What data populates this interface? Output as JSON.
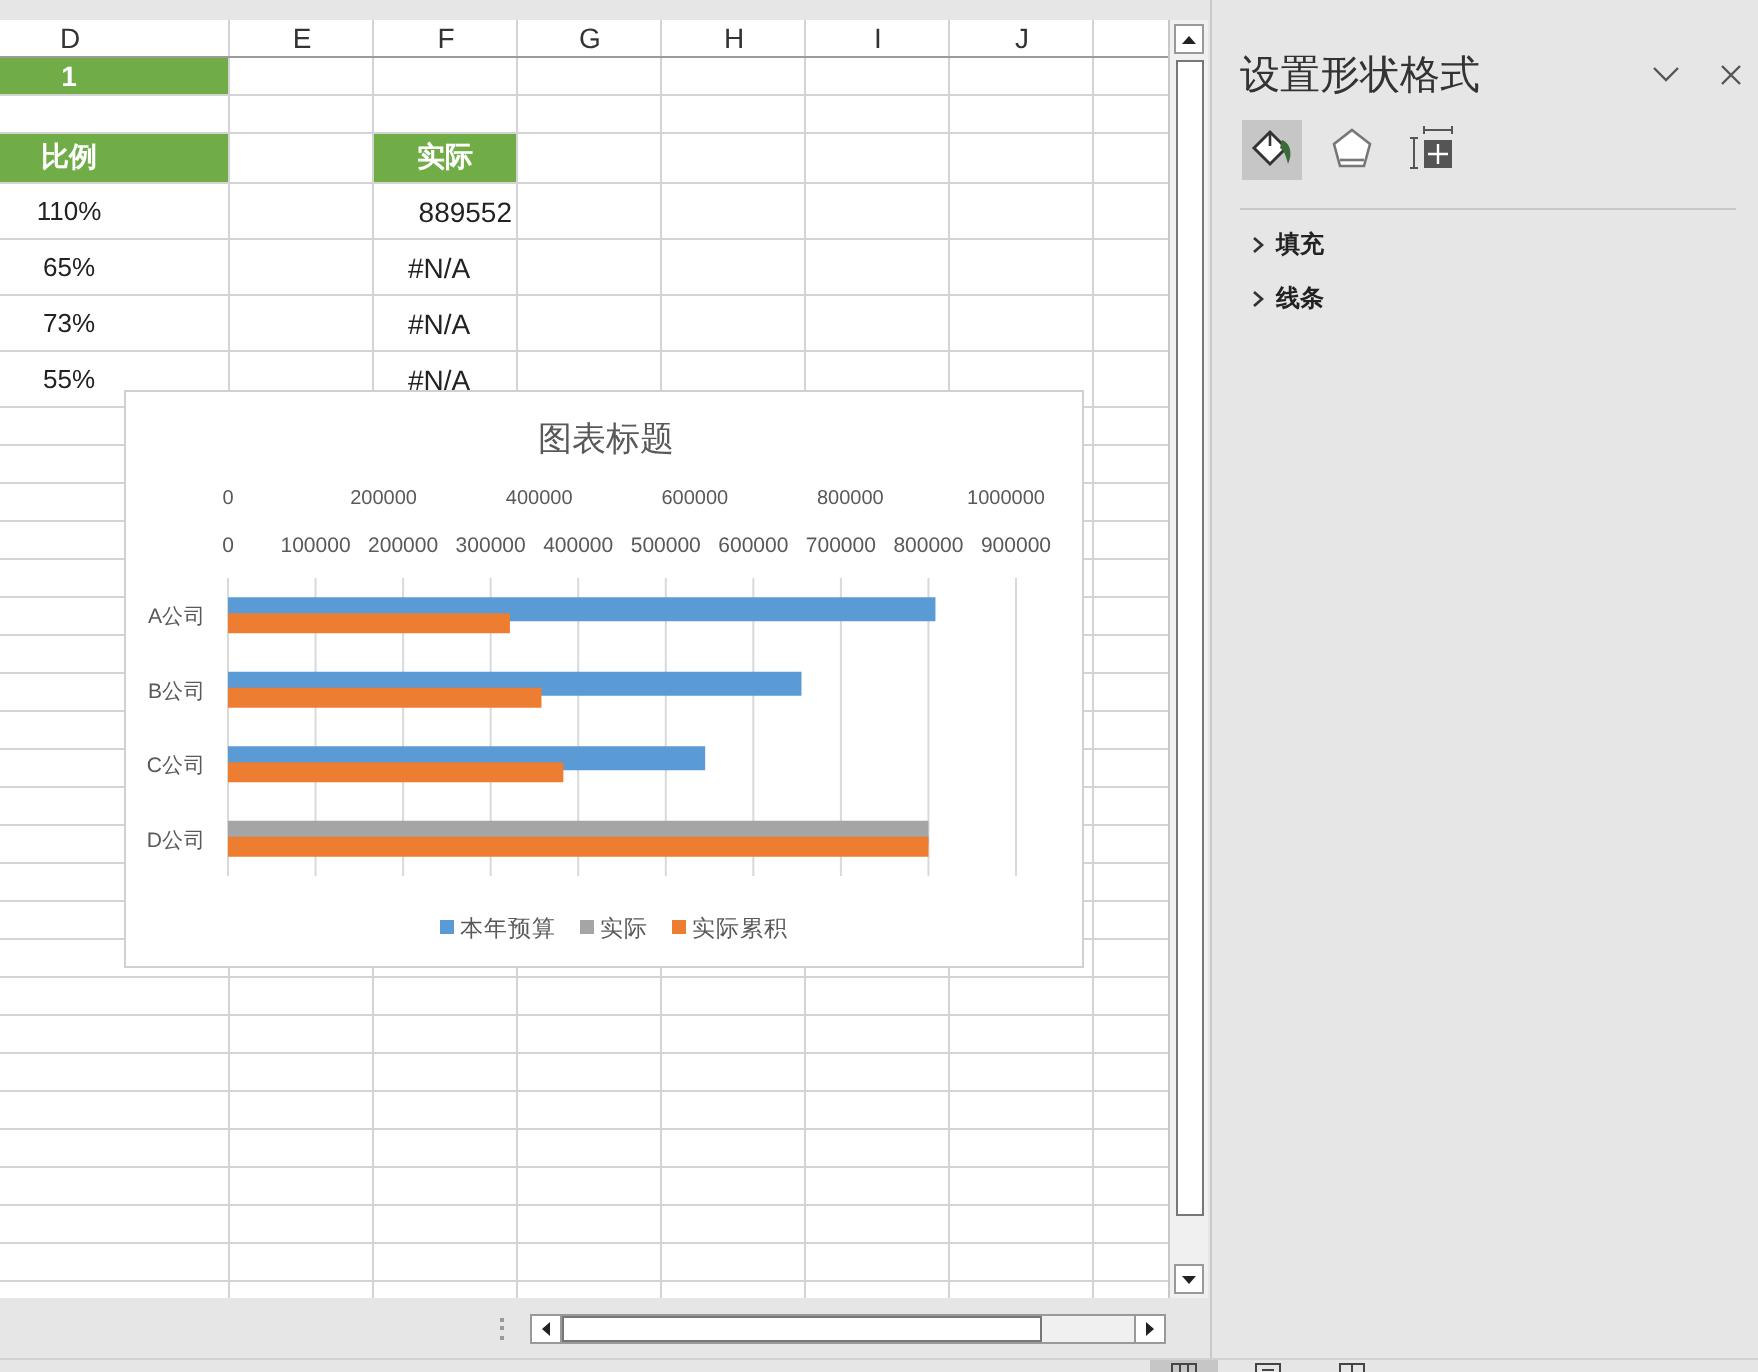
{
  "sheet": {
    "column_headers": [
      "D",
      "E",
      "F",
      "G",
      "H",
      "I",
      "J"
    ],
    "rows": [
      {
        "kind": "normal",
        "column_d": {
          "text": "1",
          "kind": "label",
          "highlight": true
        }
      },
      {
        "kind": "normal"
      },
      {
        "kind": "header",
        "column_d": {
          "text": "比例",
          "kind": "label",
          "highlight": true
        },
        "column_f": {
          "text": "实际",
          "kind": "label",
          "highlight": true
        }
      },
      {
        "kind": "tall",
        "column_d": {
          "text": "110%",
          "kind": "percent",
          "highlight": false
        },
        "column_f": {
          "text": "889552",
          "kind": "number",
          "highlight": false
        }
      },
      {
        "kind": "tall",
        "column_d": {
          "text": "65%",
          "kind": "percent",
          "highlight": false
        },
        "column_f": {
          "text": "#N/A",
          "kind": "error",
          "highlight": false
        }
      },
      {
        "kind": "tall",
        "column_d": {
          "text": "73%",
          "kind": "percent",
          "highlight": false
        },
        "column_f": {
          "text": "#N/A",
          "kind": "error",
          "highlight": false
        }
      },
      {
        "kind": "tall",
        "column_d": {
          "text": "55%",
          "kind": "percent",
          "highlight": false
        },
        "column_f": {
          "text": "#N/A",
          "kind": "error",
          "highlight": false
        }
      }
    ]
  },
  "chart": {
    "top_axis_ticks": [
      "0",
      "200000",
      "400000",
      "600000",
      "800000",
      "1000000"
    ],
    "chart_data": {
      "type": "bar",
      "orientation": "horizontal",
      "grid": true,
      "legend": true,
      "title": "图表标题",
      "categories": [
        "A公司",
        "B公司",
        "C公司",
        "D公司"
      ],
      "xlim": [
        0,
        900000
      ],
      "xticks": [
        0,
        100000,
        200000,
        300000,
        400000,
        500000,
        600000,
        700000,
        800000,
        900000
      ],
      "series": [
        {
          "name": "本年预算",
          "color": "#5b9bd5",
          "values": [
            808000,
            655000,
            545000,
            null
          ]
        },
        {
          "name": "实际",
          "color": "#a5a5a5",
          "values": [
            null,
            null,
            null,
            800000
          ]
        },
        {
          "name": "实际累积",
          "color": "#ed7d31",
          "values": [
            322000,
            358000,
            383000,
            800000
          ]
        }
      ]
    }
  },
  "pane": {
    "title": "设置形状格式",
    "tabs": [
      {
        "kind": "fill",
        "selected": true
      },
      {
        "kind": "effects",
        "selected": false
      },
      {
        "kind": "size",
        "selected": false
      }
    ],
    "sections": [
      {
        "label": "填充",
        "expanded": false
      },
      {
        "label": "线条",
        "expanded": false
      }
    ]
  },
  "status_bar": {
    "views": [
      {
        "kind": "normal",
        "selected": true
      },
      {
        "kind": "page-layout",
        "selected": false
      },
      {
        "kind": "page-break",
        "selected": false
      }
    ]
  }
}
